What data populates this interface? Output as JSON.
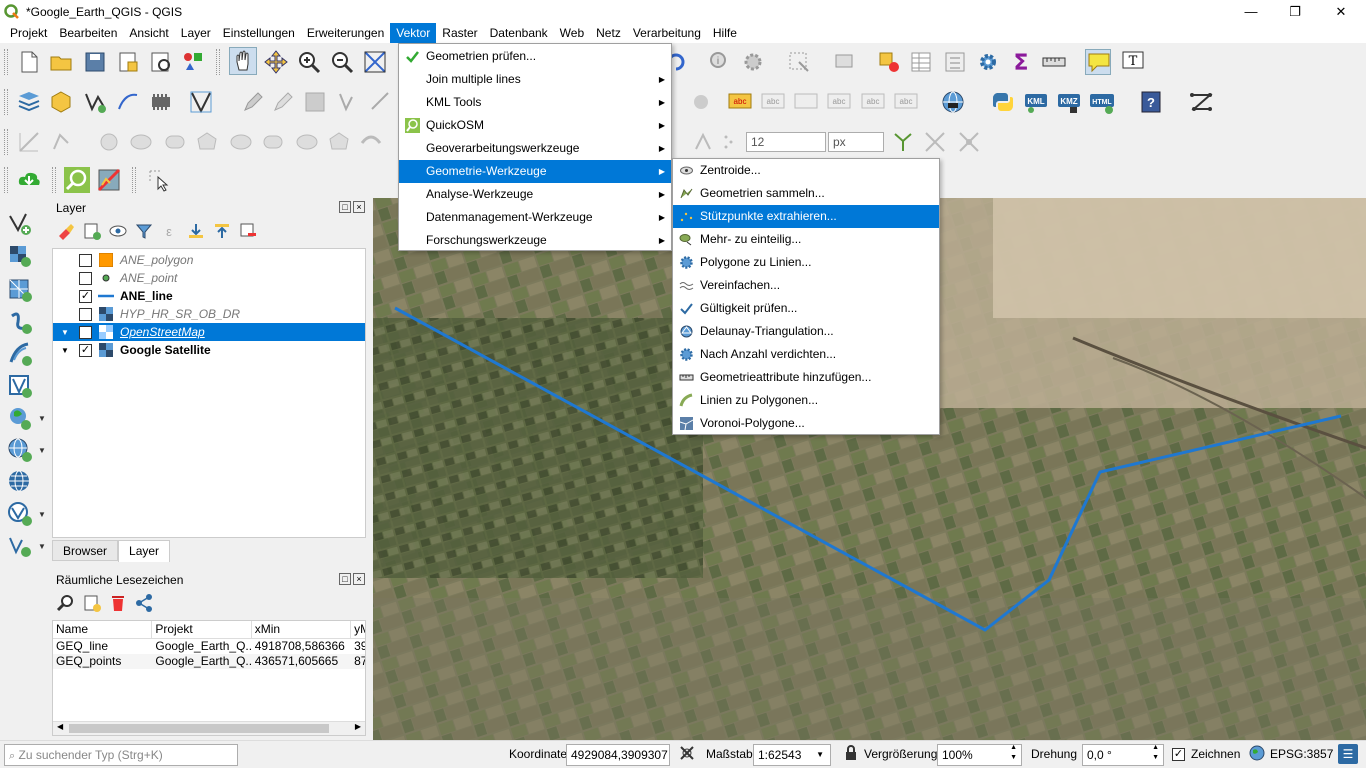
{
  "window": {
    "title": "*Google_Earth_QGIS - QGIS",
    "minimize": "—",
    "maximize": "❐",
    "close": "✕"
  },
  "menubar": [
    "Projekt",
    "Bearbeiten",
    "Ansicht",
    "Layer",
    "Einstellungen",
    "Erweiterungen",
    "Vektor",
    "Raster",
    "Datenbank",
    "Web",
    "Netz",
    "Verarbeitung",
    "Hilfe"
  ],
  "vector_menu": {
    "items": [
      {
        "label": "Geometrien prüfen...",
        "icon": "check-geometry-icon",
        "submenu": false
      },
      {
        "label": "Join multiple lines",
        "icon": "",
        "submenu": true
      },
      {
        "label": "KML Tools",
        "icon": "",
        "submenu": true
      },
      {
        "label": "QuickOSM",
        "icon": "quickosm-icon",
        "submenu": true
      },
      {
        "label": "Geoverarbeitungswerkzeuge",
        "icon": "",
        "submenu": true
      },
      {
        "label": "Geometrie-Werkzeuge",
        "icon": "",
        "submenu": true
      },
      {
        "label": "Analyse-Werkzeuge",
        "icon": "",
        "submenu": true
      },
      {
        "label": "Datenmanagement-Werkzeuge",
        "icon": "",
        "submenu": true
      },
      {
        "label": "Forschungswerkzeuge",
        "icon": "",
        "submenu": true
      }
    ],
    "highlighted": "Geometrie-Werkzeuge"
  },
  "geometry_submenu": {
    "items": [
      {
        "label": "Zentroide...",
        "icon": "centroid-icon"
      },
      {
        "label": "Geometrien sammeln...",
        "icon": "collect-geometries-icon"
      },
      {
        "label": "Stützpunkte extrahieren...",
        "icon": "extract-vertices-icon"
      },
      {
        "label": "Mehr- zu einteilig...",
        "icon": "multi-to-single-icon"
      },
      {
        "label": "Polygone zu Linien...",
        "icon": "polygon-to-lines-icon"
      },
      {
        "label": "Vereinfachen...",
        "icon": "simplify-icon"
      },
      {
        "label": "Gültigkeit prüfen...",
        "icon": "check-validity-icon"
      },
      {
        "label": "Delaunay-Triangulation...",
        "icon": "delaunay-icon"
      },
      {
        "label": "Nach Anzahl verdichten...",
        "icon": "densify-icon"
      },
      {
        "label": "Geometrieattribute hinzufügen...",
        "icon": "add-geometry-attributes-icon"
      },
      {
        "label": "Linien zu Polygonen...",
        "icon": "lines-to-polygons-icon"
      },
      {
        "label": "Voronoi-Polygone...",
        "icon": "voronoi-icon"
      }
    ],
    "highlighted": "Stützpunkte extrahieren..."
  },
  "toolbar": {
    "size_value": "12",
    "unit_value": "px"
  },
  "layers_panel": {
    "title": "Layer",
    "layers": [
      {
        "name": "ANE_polygon",
        "checked": false,
        "style": "italic",
        "symbol": "polygon-fill-orange"
      },
      {
        "name": "ANE_point",
        "checked": false,
        "style": "italic",
        "symbol": "point-marker"
      },
      {
        "name": "ANE_line",
        "checked": true,
        "style": "bold",
        "symbol": "line-blue"
      },
      {
        "name": "HYP_HR_SR_OB_DR",
        "checked": false,
        "style": "italic",
        "symbol": "raster"
      },
      {
        "name": "OpenStreetMap",
        "checked": false,
        "style": "selected",
        "symbol": "raster"
      },
      {
        "name": "Google Satellite",
        "checked": true,
        "style": "bold",
        "symbol": "raster"
      }
    ],
    "tabs": [
      "Browser",
      "Layer"
    ],
    "active_tab": "Layer"
  },
  "bookmarks_panel": {
    "title": "Räumliche Lesezeichen",
    "columns": [
      "Name",
      "Projekt",
      "xMin",
      "yM"
    ],
    "rows": [
      [
        "GEQ_line",
        "Google_Earth_Q...",
        "4918708,586366",
        "39"
      ],
      [
        "GEQ_points",
        "Google_Earth_Q...",
        "436571,605665",
        "87"
      ]
    ]
  },
  "statusbar": {
    "search_placeholder": "Zu suchender Typ (Strg+K)",
    "coordinate_label": "Koordinate",
    "coordinate_value": "4929084,3909307",
    "scale_label": "Maßstab",
    "scale_value": "1:62543",
    "magnifier_label": "Vergrößerung",
    "magnifier_value": "100%",
    "rotation_label": "Drehung",
    "rotation_value": "0,0 °",
    "render_label": "Zeichnen",
    "crs_label": "EPSG:3857"
  },
  "colors": {
    "accent": "#0078d7",
    "line": "#1f78d1",
    "polygon_symbol": "#ff9900"
  }
}
